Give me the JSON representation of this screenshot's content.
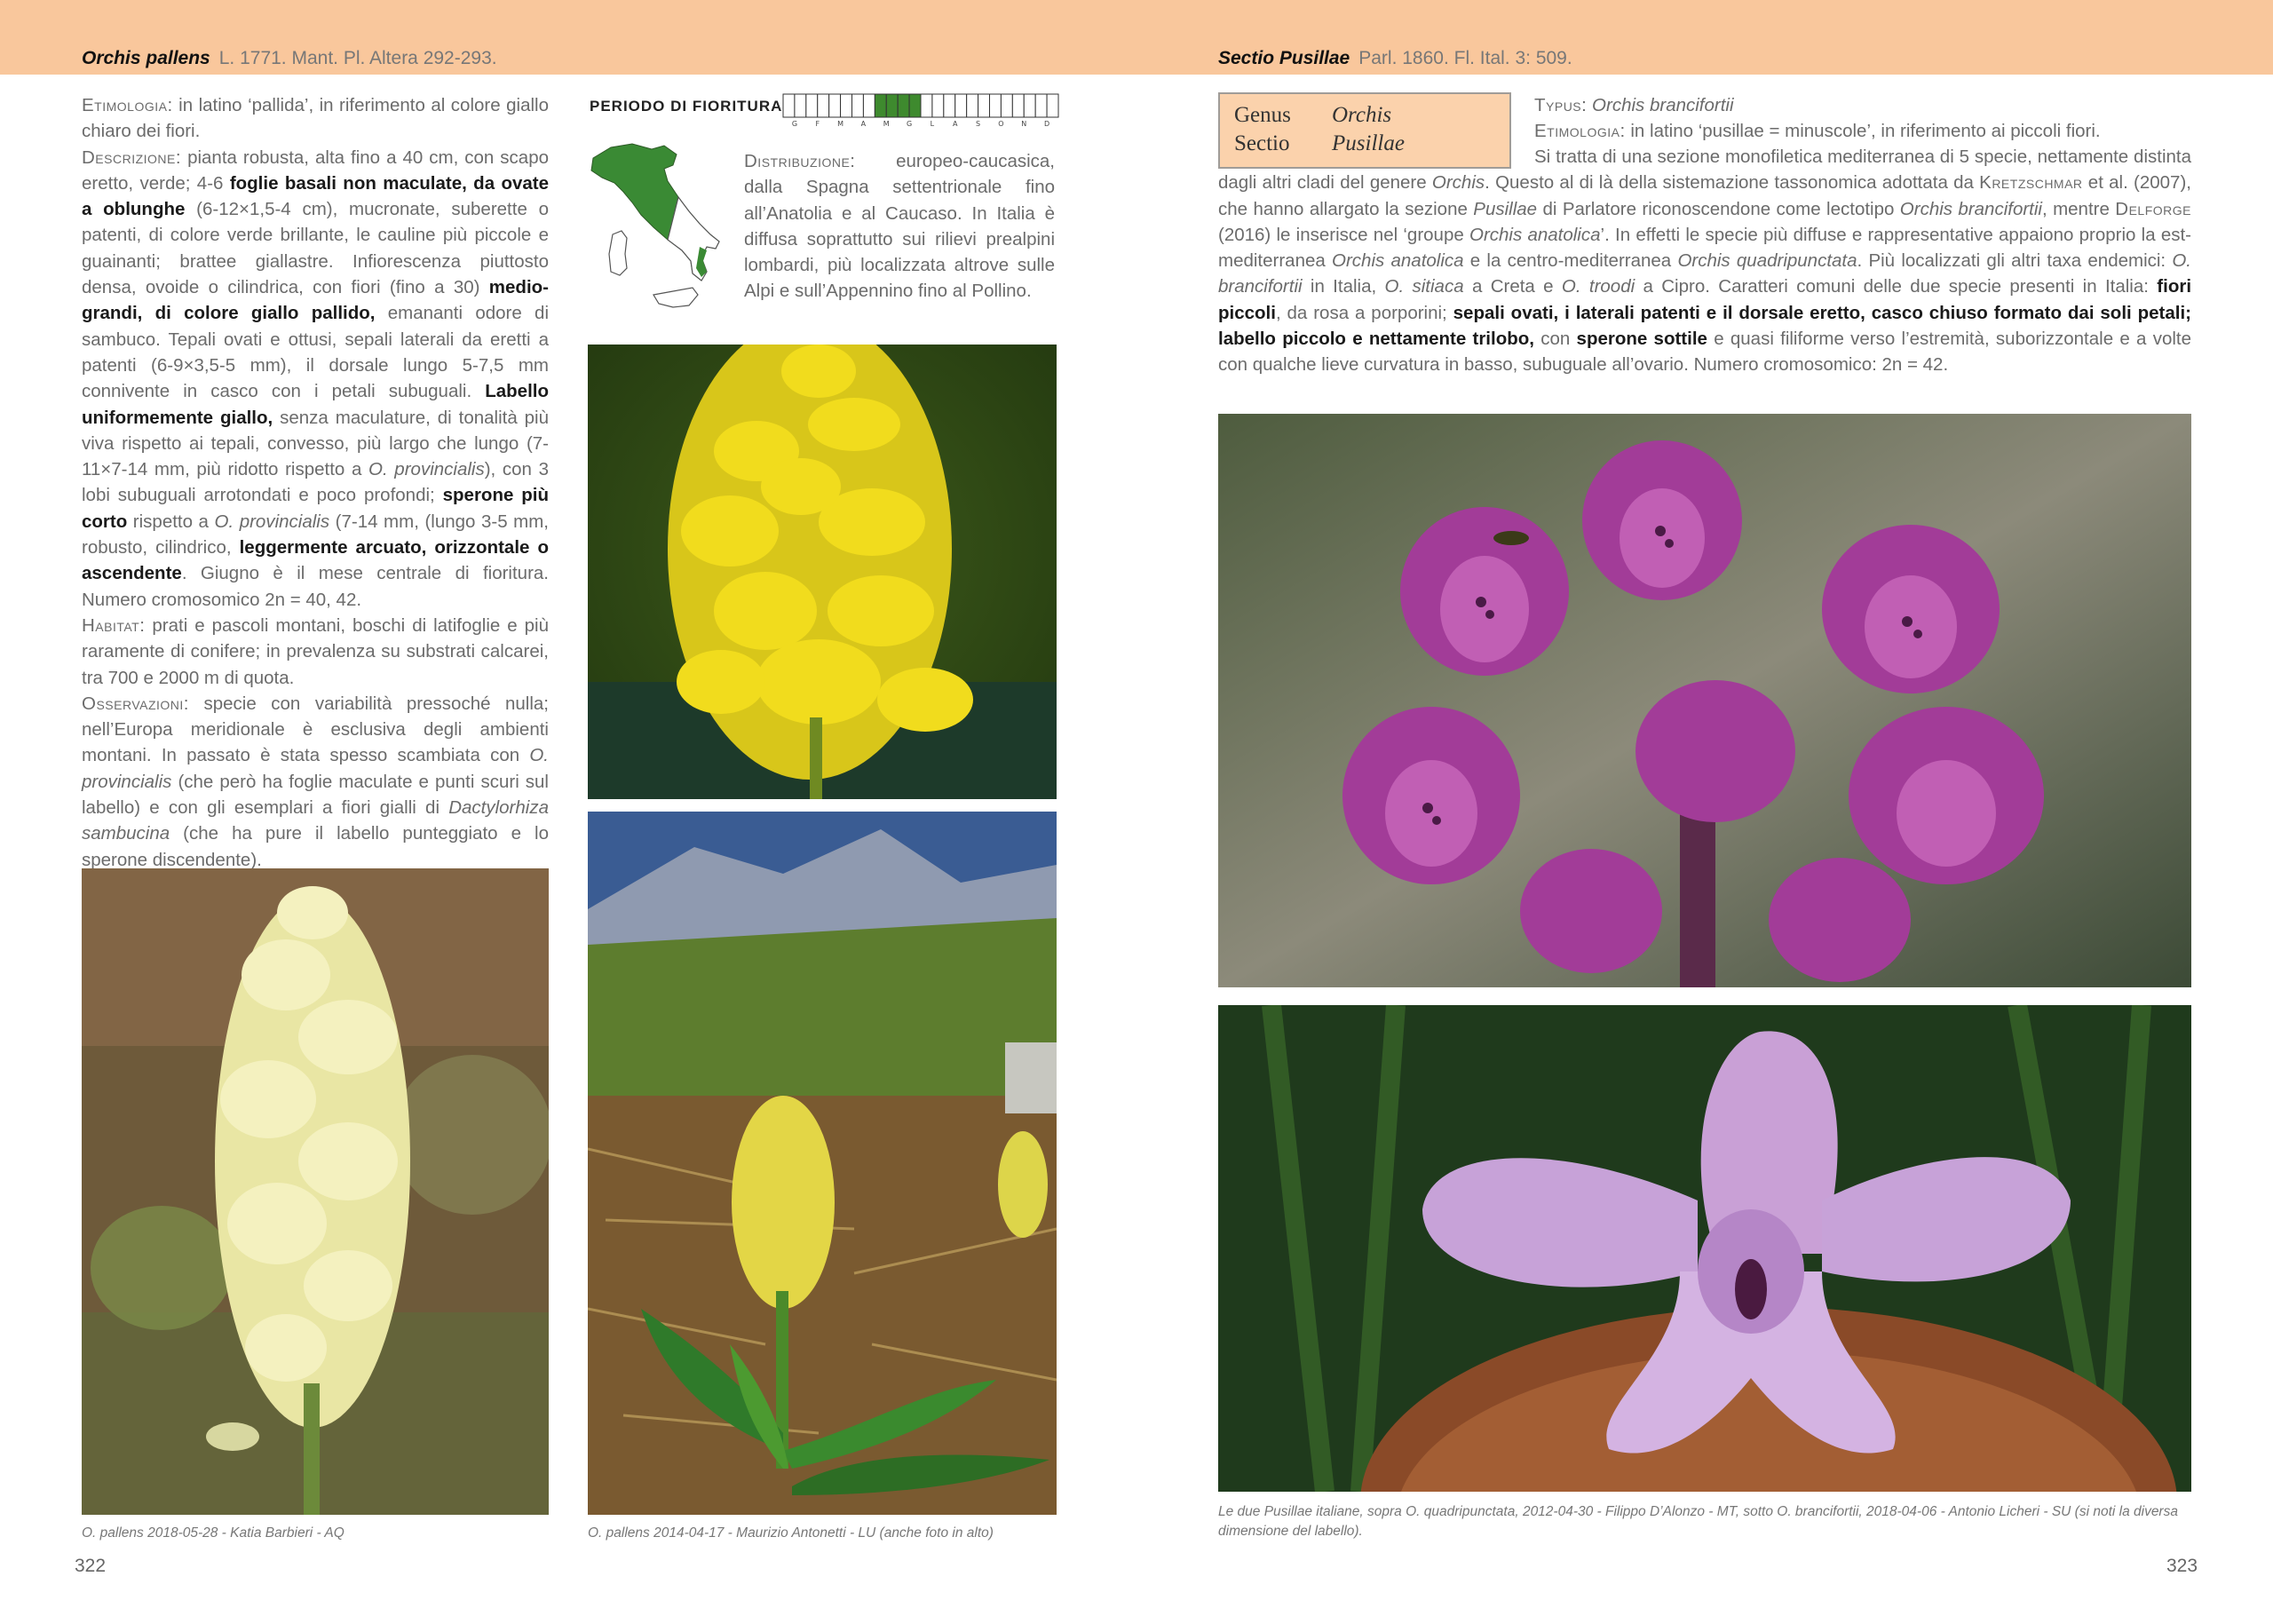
{
  "left_header": {
    "species": "Orchis pallens",
    "citation": "L. 1771. Mant. Pl. Altera 292-293."
  },
  "right_header": {
    "section": "Sectio Pusillae",
    "citation": "Parl. 1860. Fl. Ital. 3: 509."
  },
  "flowering": {
    "label": "PERIODO DI FIORITURA",
    "months": [
      "G",
      "F",
      "M",
      "A",
      "M",
      "G",
      "L",
      "A",
      "S",
      "O",
      "N",
      "D"
    ],
    "active_segments": [
      8,
      9,
      10,
      11
    ],
    "total_segments": 24
  },
  "left_text": {
    "etimologia_label": "Etimologia:",
    "etimologia": "in latino ‘pallida’, in riferimento al colore giallo chiaro dei fiori.",
    "descrizione_label": "Descrizione:",
    "descrizione": [
      {
        "t": "pianta robusta, alta fino a 40 cm, con scapo eretto, verde; 4-6 "
      },
      {
        "t": "foglie basali non maculate, da ovate a oblunghe",
        "b": true
      },
      {
        "t": " (6-12×1,5-4 cm), mucronate, suberette o patenti, di colore verde brillante, le cauline più piccole e guainanti; brattee giallastre. Infiorescenza piuttosto densa, ovoide o cilindrica, con fiori (fino a 30) "
      },
      {
        "t": "medio-grandi, di colore giallo pallido,",
        "b": true
      },
      {
        "t": " emananti odore di sambuco. Tepali ovati e ottusi, sepali laterali da eretti a patenti (6-9×3,5-5 mm), il dorsale lungo 5-7,5 mm connivente in casco con i petali subuguali. "
      },
      {
        "t": "Labello uniformemente giallo,",
        "b": true
      },
      {
        "t": " senza maculature, di tonalità più viva rispetto ai tepali, convesso, più largo che lungo (7-11×7-14 mm, più ridotto rispetto a "
      },
      {
        "t": "O. provincialis",
        "i": true
      },
      {
        "t": "), con 3 lobi subuguali arrotondati e poco profondi; "
      },
      {
        "t": "sperone più corto",
        "b": true
      },
      {
        "t": " rispetto a "
      },
      {
        "t": "O. provincialis",
        "i": true
      },
      {
        "t": " (7-14 mm, (lungo 3-5 mm, robusto, cilindrico, "
      },
      {
        "t": "leggermente arcuato, orizzontale o ascendente",
        "b": true
      },
      {
        "t": ". Giugno è il mese centrale di fioritura. Numero cromosomico 2n = 40, 42."
      }
    ],
    "habitat_label": "Habitat:",
    "habitat": "prati e pascoli montani, boschi di latifoglie e più raramente di conifere; in prevalenza su substrati calcarei, tra 700 e 2000 m di quota.",
    "osservazioni_label": "Osservazioni:",
    "osservazioni": [
      {
        "t": "specie con variabilità pressoché nulla; nell’Europa meridionale è esclusiva degli ambienti montani. In passato è stata spesso scambiata con "
      },
      {
        "t": "O. provincialis",
        "i": true
      },
      {
        "t": " (che però ha foglie maculate e punti scuri sul labello) e con gli esemplari a fiori gialli di "
      },
      {
        "t": "Dactylorhiza sambucina",
        "i": true
      },
      {
        "t": " (che ha pure il labello punteggiato e lo sperone discendente)."
      }
    ]
  },
  "distribuzione": {
    "label": "Distribuzione:",
    "text": "europeo-caucasica, dalla Spagna settentrionale fino all’Anatolia e al Caucaso. In Italia è diffusa soprattutto sui rilievi prealpini lombardi, più localizzata altrove sulle Alpi e sull’Appennino fino al Pollino."
  },
  "genus_box": {
    "genus_label": "Genus",
    "genus": "Orchis",
    "sectio_label": "Sectio",
    "sectio": "Pusillae"
  },
  "right_text": {
    "typus_label": "Typus:",
    "typus": "Orchis brancifortii",
    "etimologia_label": "Etimologia:",
    "etimologia": "in latino ‘pusillae = minuscole’, in riferimento ai piccoli fiori.",
    "body": [
      {
        "t": "Si tratta di una sezione monofiletica mediterranea di 5 specie, nettamente distinta dagli altri cladi del genere "
      },
      {
        "t": "Orchis",
        "i": true
      },
      {
        "t": ". Questo al di là della sistemazione tassonomica adottata da "
      },
      {
        "t": "Kretzschmar",
        "sc": true
      },
      {
        "t": " et al. (2007), che hanno allargato la sezione "
      },
      {
        "t": "Pusillae",
        "i": true
      },
      {
        "t": " di Parlatore riconoscendone come lectotipo "
      },
      {
        "t": "Orchis brancifortii",
        "i": true
      },
      {
        "t": ", mentre "
      },
      {
        "t": "Delforge",
        "sc": true
      },
      {
        "t": " (2016) le inserisce nel ‘groupe "
      },
      {
        "t": "Orchis anatolica",
        "i": true
      },
      {
        "t": "’. In effetti le specie più diffuse e rappresentative appaiono proprio la est-mediterranea "
      },
      {
        "t": "Orchis anatolica",
        "i": true
      },
      {
        "t": " e la centro-mediterranea "
      },
      {
        "t": "Orchis quadripunctata",
        "i": true
      },
      {
        "t": ". Più localizzati gli altri taxa endemici: "
      },
      {
        "t": "O. brancifortii",
        "i": true
      },
      {
        "t": " in Italia, "
      },
      {
        "t": "O. sitiaca",
        "i": true
      },
      {
        "t": " a Creta e "
      },
      {
        "t": "O. troodi",
        "i": true
      },
      {
        "t": " a Cipro. Caratteri comuni delle due specie presenti in Italia: "
      },
      {
        "t": "fiori piccoli",
        "b": true
      },
      {
        "t": ", da rosa a porporini; "
      },
      {
        "t": "sepali ovati, i laterali patenti e il dorsale eretto, casco chiuso formato dai soli petali; labello piccolo e nettamente trilobo,",
        "b": true
      },
      {
        "t": " con "
      },
      {
        "t": "sperone sottile",
        "b": true
      },
      {
        "t": " e quasi filiforme verso l’estremità, suborizzontale e a volte con qualche lieve curvatura in basso, subuguale all’ovario. Numero cromosomico: 2n = 42."
      }
    ]
  },
  "captions": {
    "left": "O. pallens 2018-05-28 - Katia Barbieri - AQ",
    "middle": "O. pallens 2014-04-17 - Maurizio Antonetti - LU (anche foto in alto)",
    "right": "Le due Pusillae italiane, sopra O. quadripunctata, 2012-04-30 - Filippo D’Alonzo - MT, sotto O. brancifortii, 2018-04-06 - Antonio Licheri - SU (si noti la diversa dimensione del labello)."
  },
  "page_numbers": {
    "left": "322",
    "right": "323"
  },
  "colors": {
    "header_band": "#f9c79c",
    "genus_box": "#fbd2ac",
    "flowering_active": "#3e8a2e",
    "map_green": "#3a8a34"
  }
}
